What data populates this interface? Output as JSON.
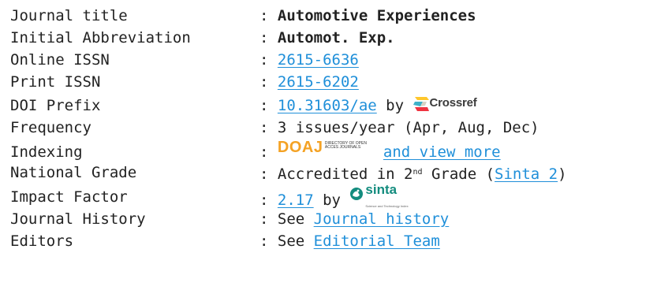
{
  "rows": {
    "journal_title": {
      "label": "Journal title",
      "sep": ": ",
      "value": "Automotive Experiences"
    },
    "abbreviation": {
      "label": "Initial Abbreviation",
      "sep": ": ",
      "value": "Automot. Exp."
    },
    "online_issn": {
      "label": "Online ISSN",
      "sep": ": ",
      "link": "2615-6636"
    },
    "print_issn": {
      "label": "Print ISSN",
      "sep": ": ",
      "link": "2615-6202"
    },
    "doi_prefix": {
      "label": "DOI Prefix",
      "sep": ": ",
      "link": "10.31603/ae",
      "by": " by ",
      "logo_text": "Crossref"
    },
    "frequency": {
      "label": "Frequency",
      "sep": ": ",
      "value": "3 issues/year (Apr, Aug, Dec)"
    },
    "indexing": {
      "label": "Indexing",
      "sep": ": ",
      "logo_main": "DOAJ",
      "logo_sub": "DIRECTORY OF OPEN ACCES JOURNALS",
      "link": "and view more "
    },
    "national_grade": {
      "label": "National Grade",
      "sep": ": ",
      "text_before": "Accredited in 2",
      "sup": "nd",
      "text_after": " Grade (",
      "link": "Sinta 2",
      "text_end": ")"
    },
    "impact_factor": {
      "label": "Impact Factor",
      "sep": ": ",
      "link": "2.17",
      "by": " by ",
      "logo_text": "sinta",
      "logo_sub": "Science and Technology Index"
    },
    "journal_history": {
      "label": "Journal History",
      "sep": ": ",
      "prefix": "See ",
      "link": "Journal history "
    },
    "editors": {
      "label": "Editors",
      "sep": ": ",
      "prefix": "See ",
      "link": "Editorial Team "
    }
  },
  "colors": {
    "text": "#222222",
    "link": "#1f8fd9",
    "doaj_orange": "#f4a224",
    "sinta_teal": "#138c7e",
    "crossref_yellow": "#ffc72c",
    "crossref_blue": "#3eb1c8",
    "crossref_red": "#ef3340"
  }
}
